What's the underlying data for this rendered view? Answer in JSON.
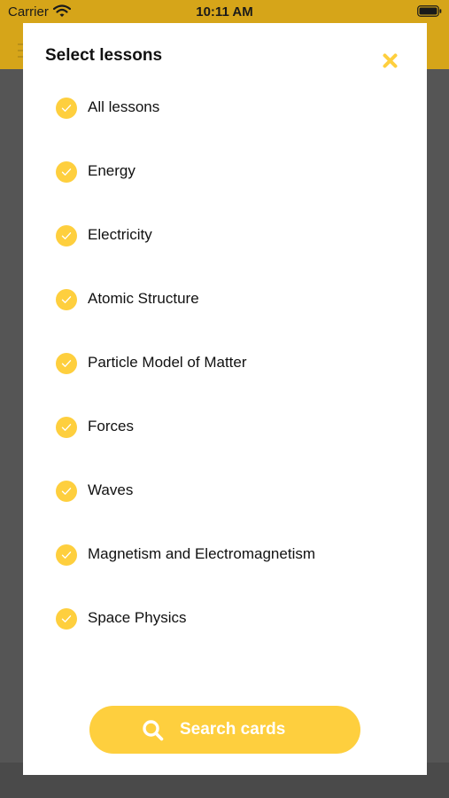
{
  "status_bar": {
    "carrier": "Carrier",
    "time": "10:11 AM"
  },
  "modal": {
    "title": "Select lessons",
    "close_icon": "close-icon",
    "check_icon": "check-circle-icon",
    "lessons": [
      {
        "label": "All lessons",
        "selected": true
      },
      {
        "label": "Energy",
        "selected": true
      },
      {
        "label": "Electricity",
        "selected": true
      },
      {
        "label": "Atomic Structure",
        "selected": true
      },
      {
        "label": "Particle Model of Matter",
        "selected": true
      },
      {
        "label": "Forces",
        "selected": true
      },
      {
        "label": "Waves",
        "selected": true
      },
      {
        "label": "Magnetism and Electromagnetism",
        "selected": true
      },
      {
        "label": "Space Physics",
        "selected": true
      }
    ],
    "search_button": {
      "label": "Search cards",
      "icon": "search-icon"
    }
  },
  "colors": {
    "accent": "#fecf3e",
    "header": "#d6a519",
    "overlay": "#555555",
    "modal_background": "#ffffff",
    "text": "#111111"
  }
}
